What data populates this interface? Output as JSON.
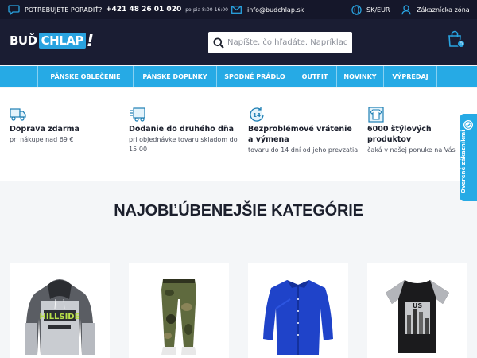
{
  "topbar": {
    "help_label": "POTREBUJETE PORADIŤ?",
    "phone": "+421 48 26 01 020",
    "hours": "po-pia 8:00-16:00",
    "email": "info@budchlap.sk",
    "locale": "SK/EUR",
    "account_label": "Zákaznícka zóna"
  },
  "header": {
    "logo": {
      "word1": "BUĎ",
      "word2": "CHLAP",
      "mark": "!"
    },
    "search_placeholder": "Napíšte, čo hľadáte. Napríklad mikina",
    "cart_count": "0"
  },
  "nav": {
    "items": [
      {
        "label": "PÁNSKE OBLEČENIE"
      },
      {
        "label": "PÁNSKE DOPLNKY"
      },
      {
        "label": "SPODNÉ PRÁDLO"
      },
      {
        "label": "OUTFIT"
      },
      {
        "label": "NOVINKY"
      },
      {
        "label": "VÝPREDAJ"
      }
    ]
  },
  "features": [
    {
      "icon": "delivery-truck-icon",
      "title": "Doprava zdarma",
      "sub": "pri nákupe nad 69 €"
    },
    {
      "icon": "fast-delivery-icon",
      "title": "Dodanie do druhého dňa",
      "sub": "pri objednávke tovaru skladom do 15:00"
    },
    {
      "icon": "return-14-icon",
      "title": "Bezproblémové vrátenie a výmena",
      "sub": "tovaru do 14 dní od jeho prevzatia"
    },
    {
      "icon": "shirt-icon",
      "title": "6000 štýlových produktov",
      "sub": "čaká v našej ponuke na Vás"
    }
  ],
  "side_tab": {
    "label": "Overené zákazníkmi"
  },
  "categories": {
    "title": "NAJOBĽÚBENEJŠIE KATEGÓRIE",
    "items": [
      {
        "image": "hoodie",
        "print_text": "HILLSIDE"
      },
      {
        "image": "camo-pants"
      },
      {
        "image": "blue-shirt"
      },
      {
        "image": "raglan-tshirt",
        "print_text": "US"
      }
    ]
  },
  "colors": {
    "topbar": "#15172a",
    "header": "#1a1d33",
    "accent": "#26aae5",
    "page_bg": "#f4f6f8"
  }
}
